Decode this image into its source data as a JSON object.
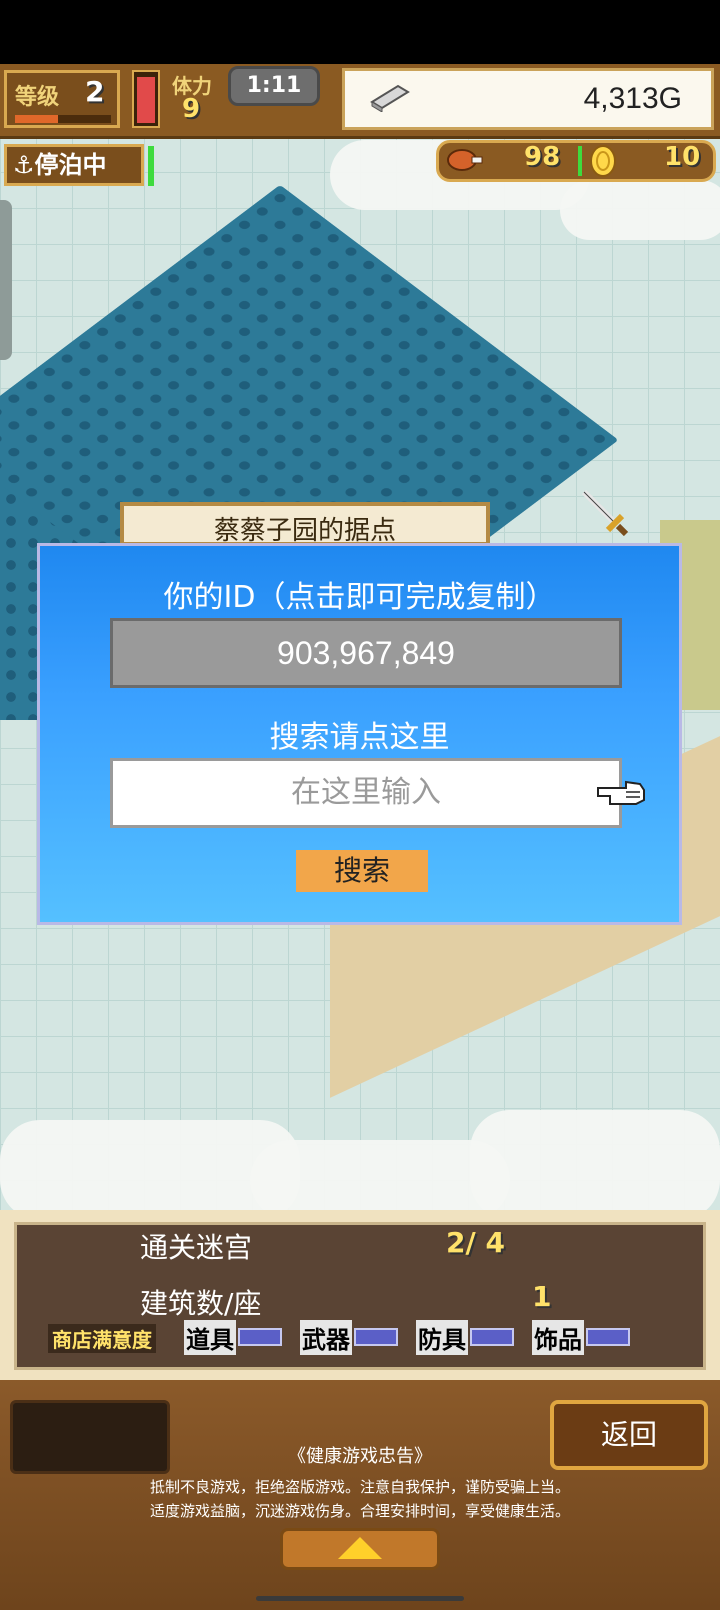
{
  "hud": {
    "level_label": "等级",
    "level_value": "2",
    "level_progress": 0.45,
    "stamina_level": 0.95,
    "stamina_label": "体力",
    "stamina_value": "9",
    "timer": "1:11",
    "money": "4,313G",
    "dock_status": "停泊中",
    "food_value": "98",
    "coin_value": "10"
  },
  "map": {
    "sign_text": "蔡蔡子园的据点"
  },
  "dialog": {
    "title": "你的ID（点击即可完成复制）",
    "id_value": "903,967,849",
    "search_label": "搜索请点这里",
    "search_placeholder": "在这里输入",
    "search_button": "搜索"
  },
  "info": {
    "dungeon_label": "通关迷宫",
    "dungeon_value": "2/ 4",
    "buildings_label": "建筑数/座",
    "buildings_value": "1",
    "satisfaction_label": "商店满意度",
    "categories": [
      "道具",
      "武器",
      "防具",
      "饰品"
    ]
  },
  "bottom": {
    "return_button": "返回",
    "notice_title": "《健康游戏忠告》",
    "notice_line1": "抵制不良游戏，拒绝盗版游戏。注意自我保护，谨防受骗上当。",
    "notice_line2": "适度游戏益脑，沉迷游戏伤身。合理安排时间，享受健康生活。"
  },
  "colors": {
    "dialog_blue": "#3aa0ff",
    "button_orange": "#f2a64a",
    "hud_brown": "#8a5a22",
    "highlight_yellow": "#ffe26a"
  }
}
